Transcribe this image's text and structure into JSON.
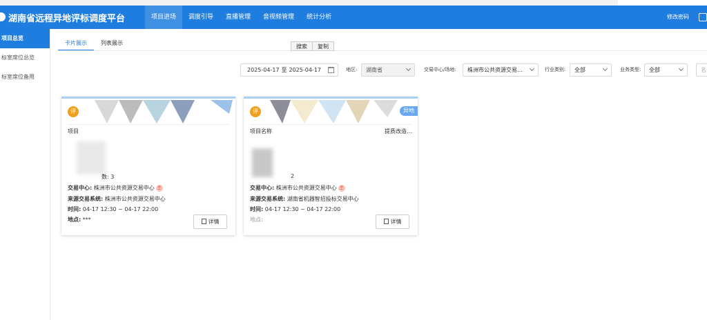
{
  "header": {
    "title": "湖南省远程异地评标调度平台",
    "nav": [
      "项目进场",
      "调度引导",
      "直播管理",
      "音视频管理",
      "统计分析"
    ],
    "change_password": "修改密码"
  },
  "sidebar": {
    "items": [
      "项目总览",
      "标室席位总览",
      "标室席位备用"
    ]
  },
  "tabs": [
    "卡片展示",
    "列表展示"
  ],
  "buttons": {
    "search": "搜索",
    "copy": "复制"
  },
  "filters": {
    "date_start": "2025-04-17",
    "date_sep": "至",
    "date_end": "2025-04-17",
    "region_label": "地区:",
    "region_value": "湖南省",
    "center_label": "交易中心/场地:",
    "center_value": "株洲市公共资源交易…",
    "industry_label": "行业类别:",
    "industry_value": "全部",
    "business_label": "业务类型:",
    "business_value": "全部",
    "name_placeholder": "名"
  },
  "cards": [
    {
      "badge": "评",
      "title": "项目",
      "title_tail": "",
      "remote_tag": "",
      "count_text": "数: 3",
      "center_label": "交易中心:",
      "center_value": "株洲市公共资源交易中心",
      "main_tag": "主",
      "source_label": "来源交易系统:",
      "source_value": "株洲市公共资源交易中心",
      "time_label": "时间:",
      "time_value": "04-17 12:30 ~ 04-17 22:00",
      "place_label": "地点:",
      "place_value": "***",
      "detail": "详情"
    },
    {
      "badge": "评",
      "title": "项目名称",
      "title_tail": "提质改造…",
      "remote_tag": "异地",
      "count_text": "2",
      "center_label": "交易中心:",
      "center_value": "株洲市公共资源交易中心",
      "main_tag": "主",
      "source_label": "来源交易系统:",
      "source_value": "湖南省机器智招投标交易中心",
      "time_label": "时间:",
      "time_value": "04-17 12:30 ~ 04-17 22:00",
      "place_label": "地点:",
      "place_value": "",
      "detail": "详情"
    }
  ]
}
